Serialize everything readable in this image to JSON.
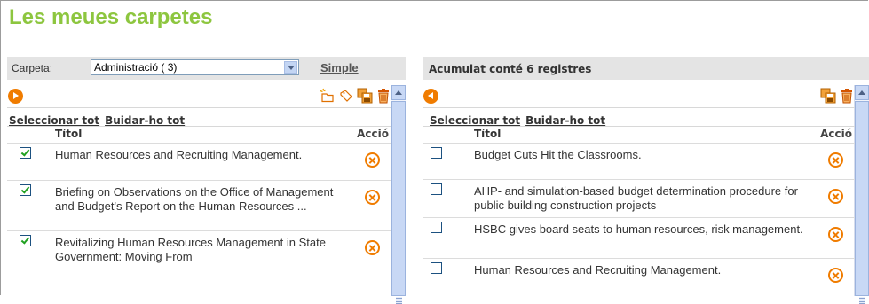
{
  "title": "Les meues carpetes",
  "left": {
    "folder_label": "Carpeta:",
    "folder_value": "Administració ( 3)",
    "simple_link": "Simple",
    "toolbar_icons": [
      "new-folder-icon",
      "tag-icon",
      "save-icon",
      "trash-icon"
    ],
    "select_all": "Seleccionar tot",
    "clear_all": "Buidar-ho tot",
    "col_title": "Títol",
    "col_action": "Acció",
    "rows": [
      {
        "checked": true,
        "text": "Human Resources and Recruiting Management."
      },
      {
        "checked": true,
        "text": "Briefing on Observations on the Office of Management and Budget's Report on the Human Resources ..."
      },
      {
        "checked": true,
        "text": "Revitalizing Human Resources Management in State Government: Moving From"
      }
    ]
  },
  "right": {
    "header": "Acumulat conté 6 registres",
    "toolbar_icons": [
      "save-icon",
      "trash-icon"
    ],
    "select_all": "Seleccionar tot",
    "clear_all": "Buidar-ho tot",
    "col_title": "Títol",
    "col_action": "Acció",
    "rows": [
      {
        "checked": false,
        "text": "Budget Cuts Hit the Classrooms."
      },
      {
        "checked": false,
        "text": "AHP- and simulation-based budget determination procedure for public building construction projects"
      },
      {
        "checked": false,
        "text": "HSBC gives board seats to human resources, risk management."
      },
      {
        "checked": false,
        "text": "Human Resources and Recruiting Management."
      }
    ]
  },
  "colors": {
    "title": "#8dc63f",
    "accent": "#f07c00",
    "bar": "#e4e4e4"
  }
}
